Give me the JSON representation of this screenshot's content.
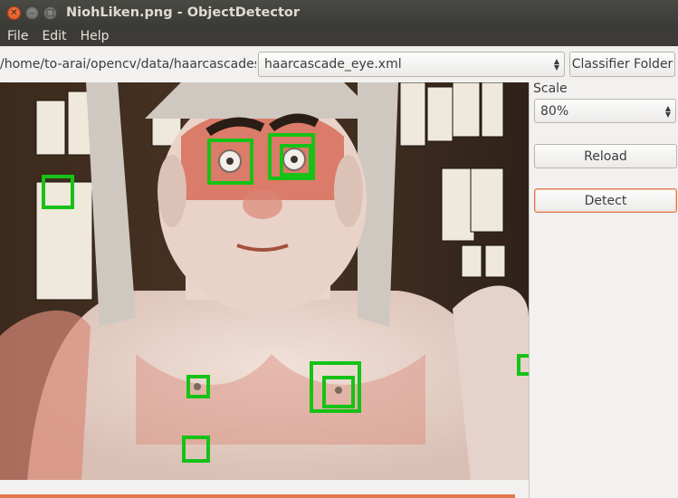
{
  "window": {
    "title": "NiohLiken.png - ObjectDetector",
    "close_glyph": "✕",
    "minimize_glyph": "–",
    "maximize_glyph": "□"
  },
  "menu": [
    "File",
    "Edit",
    "Help"
  ],
  "toolbar": {
    "path": "/home/to-arai/opencv/data/haarcascades",
    "classifier": "haarcascade_eye.xml",
    "classifier_folder_button": "Classifier Folder"
  },
  "panel": {
    "scale_label": "Scale",
    "scale_value": "80%",
    "reload_button": "Reload",
    "detect_button": "Detect"
  },
  "progress": {
    "value": 0.975
  },
  "colors": {
    "detection_box": "#16c216",
    "accent": "#e2784a"
  }
}
